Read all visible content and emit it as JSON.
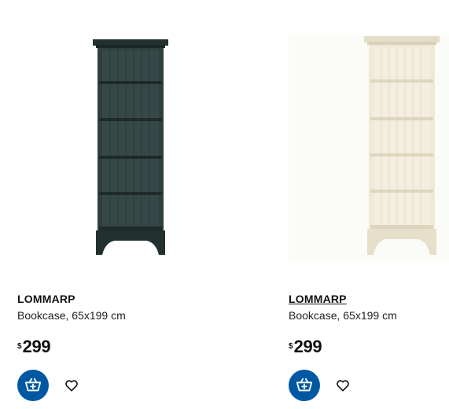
{
  "products": [
    {
      "name": "LOMMARP",
      "description": "Bookcase, 65x199 cm",
      "currency": "$",
      "price": "299",
      "color": "#2c3b3a",
      "icons": {
        "cart": "add-to-cart-icon",
        "favourite": "heart-icon"
      }
    },
    {
      "name": "LOMMARP",
      "description": "Bookcase, 65x199 cm",
      "currency": "$",
      "price": "299",
      "color": "#ece6d3",
      "icons": {
        "cart": "add-to-cart-icon",
        "favourite": "heart-icon"
      }
    }
  ],
  "colors": {
    "accent": "#0058a3"
  }
}
